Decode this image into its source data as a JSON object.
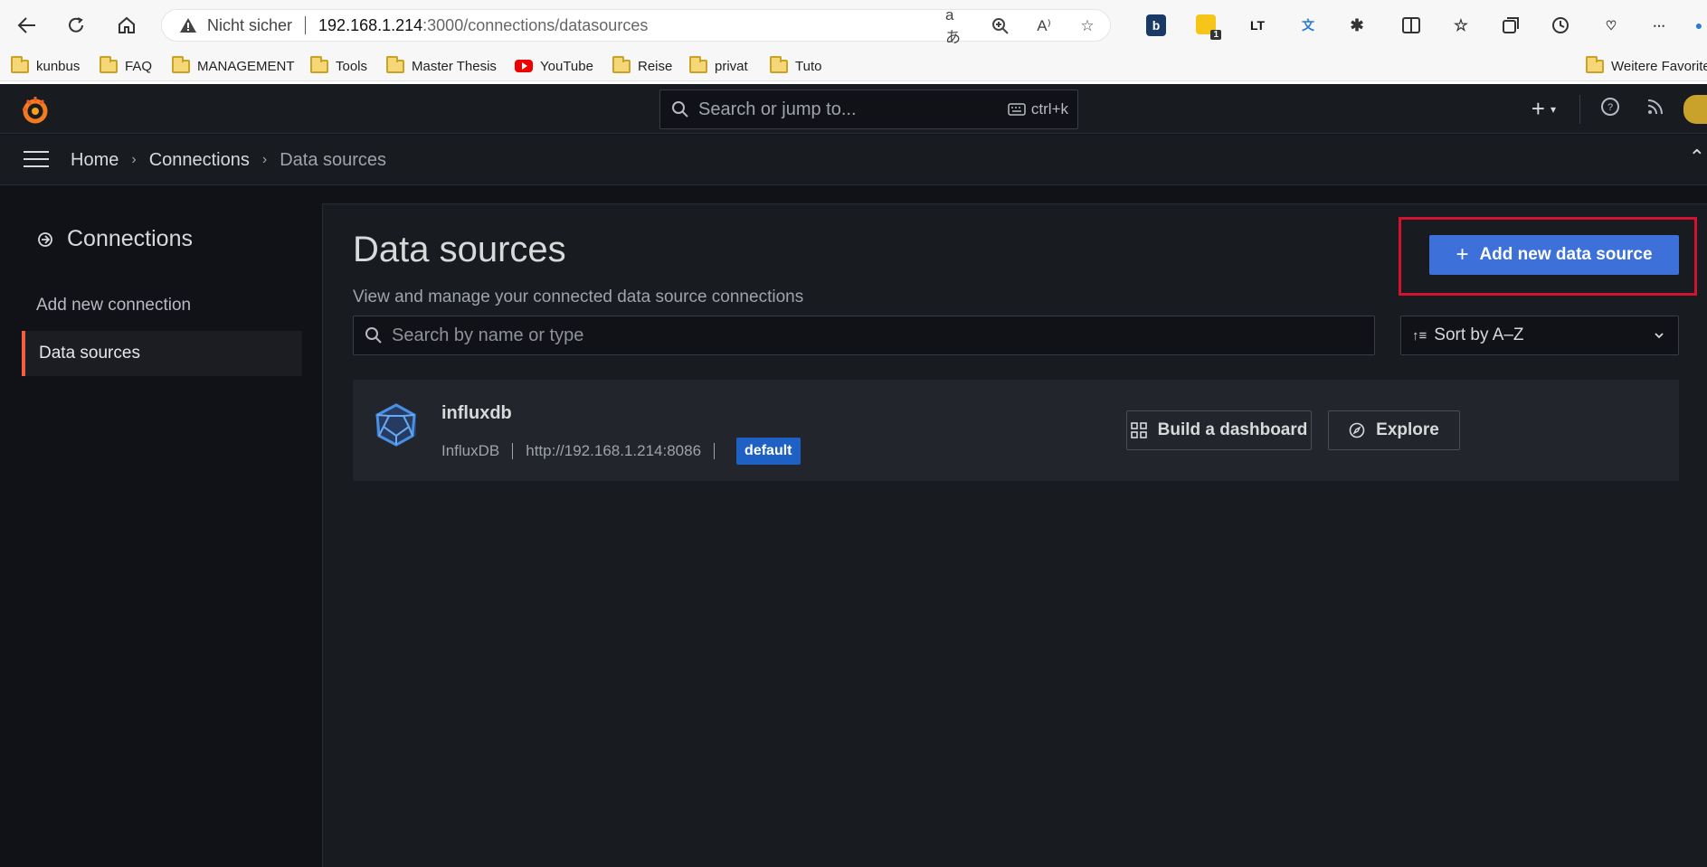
{
  "browser": {
    "security_label": "Nicht sicher",
    "url_host": "192.168.1.214",
    "url_path": ":3000/connections/datasources",
    "extension_badge": "1"
  },
  "bookmarks": [
    {
      "label": "kunbus",
      "type": "folder"
    },
    {
      "label": "FAQ",
      "type": "folder"
    },
    {
      "label": "MANAGEMENT",
      "type": "folder"
    },
    {
      "label": "Tools",
      "type": "folder"
    },
    {
      "label": "Master Thesis",
      "type": "folder"
    },
    {
      "label": "YouTube",
      "type": "youtube"
    },
    {
      "label": "Reise",
      "type": "folder"
    },
    {
      "label": "privat",
      "type": "folder"
    },
    {
      "label": "Tuto",
      "type": "folder"
    }
  ],
  "bookmarks_other": "Weitere Favorite",
  "grafana": {
    "search_placeholder": "Search or jump to...",
    "search_shortcut": "ctrl+k",
    "breadcrumbs": [
      "Home",
      "Connections",
      "Data sources"
    ],
    "sidebar": {
      "title": "Connections",
      "items": [
        {
          "label": "Add new connection",
          "active": false
        },
        {
          "label": "Data sources",
          "active": true
        }
      ]
    },
    "page": {
      "title": "Data sources",
      "subtitle": "View and manage your connected data source connections",
      "add_button": "Add new data source",
      "search_placeholder": "Search by name or type",
      "sort_label": "Sort by A–Z"
    },
    "datasource": {
      "name": "influxdb",
      "type": "InfluxDB",
      "url": "http://192.168.1.214:8086",
      "badge": "default",
      "build_button": "Build a dashboard",
      "explore_button": "Explore"
    }
  },
  "colors": {
    "primary": "#3d71d9",
    "highlight_box": "#d2122e",
    "active_accent": "#f55f3e"
  }
}
